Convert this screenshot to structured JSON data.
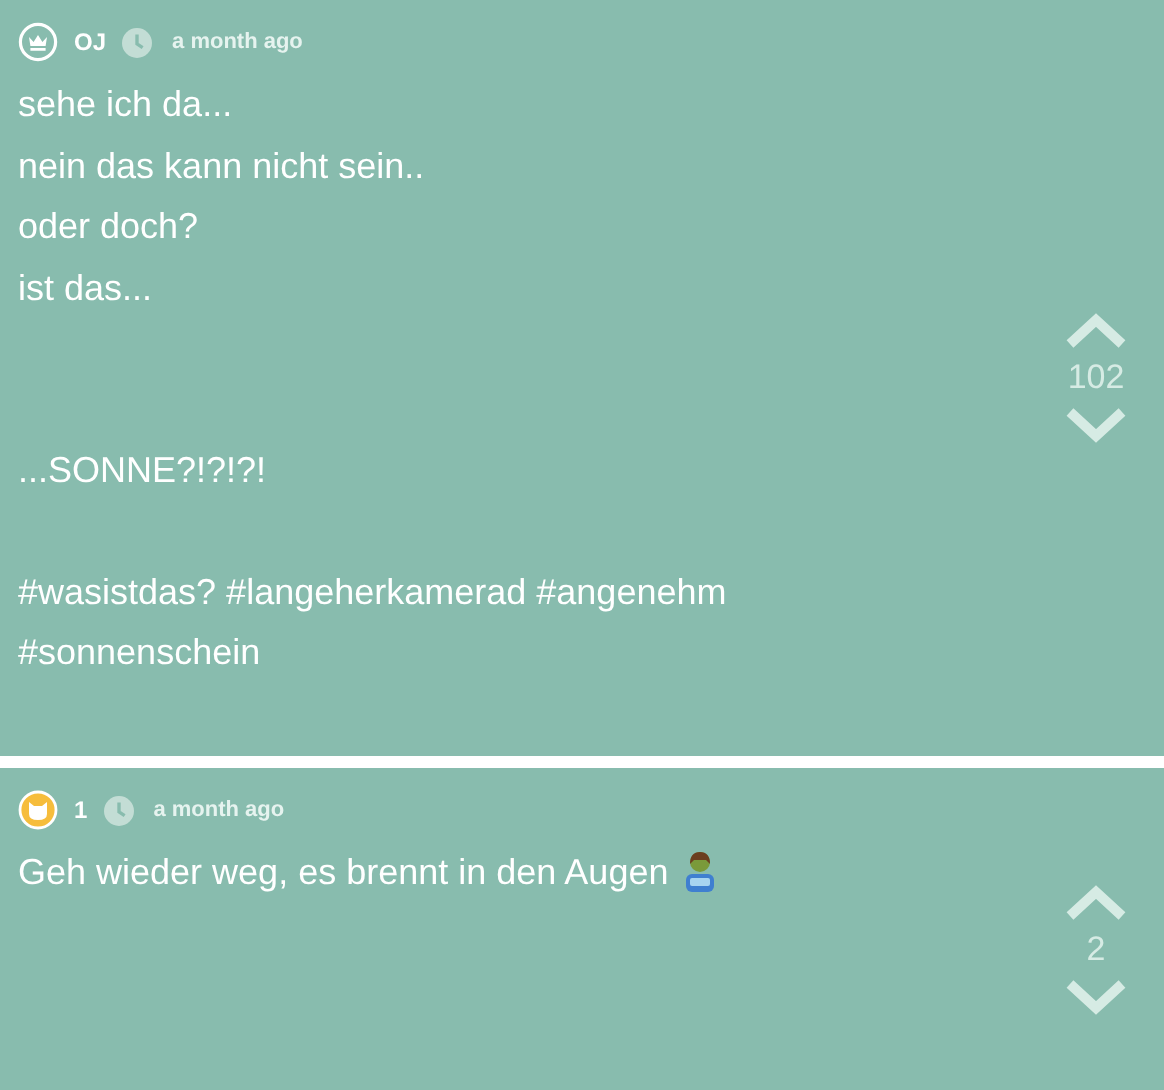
{
  "posts": [
    {
      "avatar": {
        "kind": "crown"
      },
      "author": "OJ",
      "time": "a month ago",
      "paragraphs": [
        [
          "sehe ich da...",
          "nein das kann nicht sein..",
          "oder doch?",
          "ist das..."
        ],
        [
          "...SONNE?!?!?!"
        ],
        [
          "#wasistdas? #langeherkamerad #angenehm",
          "#sonnenschein"
        ]
      ],
      "emoji": false,
      "votes": "102"
    },
    {
      "avatar": {
        "kind": "cat"
      },
      "author": "1",
      "time": "a month ago",
      "paragraphs": [
        [
          "Geh wieder weg, es brennt in den Augen"
        ]
      ],
      "emoji": true,
      "votes": "2"
    }
  ]
}
